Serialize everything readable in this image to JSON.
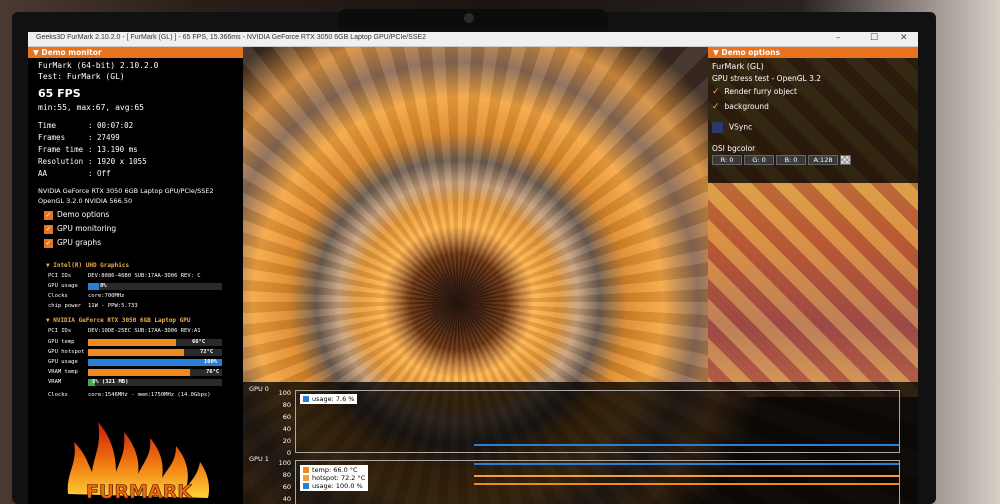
{
  "window": {
    "title": "Geeks3D FurMark 2.10.2.0 - [ FurMark (GL) ] - 65 FPS, 15.366ms - NVIDIA GeForce RTX 3050 6GB Laptop GPU/PCIe/SSE2",
    "min": "–",
    "max": "☐",
    "close": "✕"
  },
  "monitor": {
    "header": "▼ Demo monitor",
    "app_line": "FurMark (64-bit) 2.10.2.0",
    "test_line": "Test: FurMark (GL)",
    "fps": "65 FPS",
    "fps_stats": "min:55, max:67, avg:65",
    "stats": [
      {
        "k": "Time",
        "v": ": 00:07:02"
      },
      {
        "k": "Frames",
        "v": ": 27499"
      },
      {
        "k": "Frame time",
        "v": ": 13.190 ms"
      },
      {
        "k": "Resolution",
        "v": ": 1920 x 1055"
      },
      {
        "k": "AA",
        "v": ": Off"
      }
    ],
    "gpu_name": "NVIDIA GeForce RTX 3050 6GB Laptop GPU/PCIe/SSE2",
    "opengl": "OpenGL 3.2.0 NVIDIA 566.50",
    "checkboxes": [
      "Demo options",
      "GPU monitoring",
      "GPU graphs"
    ]
  },
  "intel": {
    "title": "▼ Intel(R) UHD Graphics",
    "pci_label": "PCI IDs",
    "pci_value": "DEV:8086-46B0 SUB:17AA-3D06 REV: C",
    "usage_label": "GPU usage",
    "usage_value": "8%",
    "usage_pct": 8,
    "clocks_label": "Clocks",
    "clocks_value": "core:700MHz",
    "power_label": "chip power",
    "power_value": "11W - PPW:5.733"
  },
  "nvidia": {
    "title": "▼ NVIDIA GeForce RTX 3050 6GB Laptop GPU",
    "pci_label": "PCI IDs",
    "pci_value": "DEV:10DE-25EC SUB:17AA-3D06 REV:A1",
    "bars": [
      {
        "label": "GPU temp",
        "value": "66°C",
        "pct": 66,
        "color": "#f08a1c"
      },
      {
        "label": "GPU hotspot",
        "value": "72°C",
        "pct": 72,
        "color": "#f08a1c"
      },
      {
        "label": "GPU usage",
        "value": "100%",
        "pct": 100,
        "color": "#2a7fd4"
      },
      {
        "label": "VRAM temp",
        "value": "76°C",
        "pct": 76,
        "color": "#f08a1c"
      },
      {
        "label": "VRAM",
        "value": "5% (321 MB)",
        "pct": 5,
        "color": "#38b04a"
      }
    ],
    "clocks_label": "Clocks",
    "clocks_value": "core:1546MHz - mem:1750MHz (14.0Gbps)"
  },
  "logo_text": "FURMARK",
  "options": {
    "header": "▼ Demo options",
    "demo": "FurMark (GL)",
    "test": "GPU stress test - OpenGL 3.2",
    "checks": [
      "Render furry object",
      "background"
    ],
    "vsync": "VSync",
    "bg_label": "OSI bgcolor",
    "chips": [
      "R: 0",
      "G: 0",
      "B: 0",
      "A:128"
    ]
  },
  "graphs": {
    "gpu0_label": "GPU 0",
    "gpu0_ticks": [
      "100",
      "80",
      "60",
      "40",
      "20",
      "0"
    ],
    "gpu0_legend": "usage: 7.6 %",
    "gpu1_label": "GPU 1",
    "gpu1_ticks": [
      "100",
      "80",
      "60",
      "40"
    ],
    "gpu1_legend": [
      {
        "text": "temp: 66.0 °C",
        "color": "#f08a1c"
      },
      {
        "text": "hotspot: 72.2 °C",
        "color": "#f0a040"
      },
      {
        "text": "usage: 100.0 %",
        "color": "#2a7fd4"
      }
    ]
  }
}
